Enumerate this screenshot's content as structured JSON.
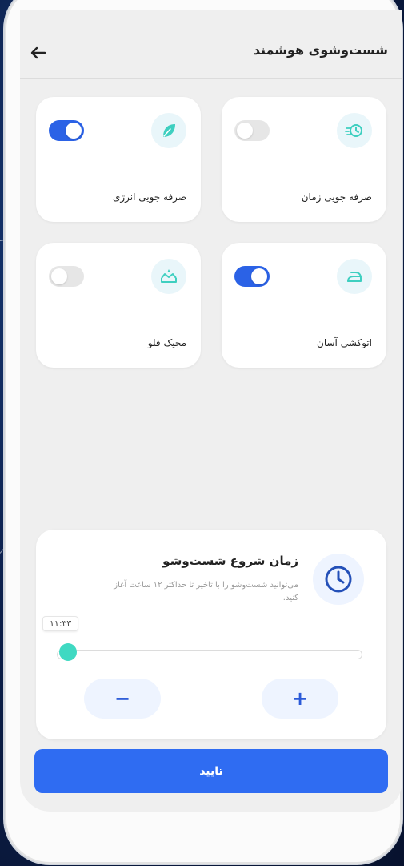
{
  "header": {
    "title": "شست‌وشوی هوشمند",
    "back_icon": "arrow-left-icon"
  },
  "options": [
    {
      "label": "صرفه جویی زمان",
      "icon": "fast-clock-icon",
      "enabled": false
    },
    {
      "label": "صرفه جویی انرژی",
      "icon": "leaf-icon",
      "enabled": true
    },
    {
      "label": "اتوکشی آسان",
      "icon": "iron-icon",
      "enabled": true
    },
    {
      "label": "مجیک فلو",
      "icon": "water-crown-icon",
      "enabled": false
    }
  ],
  "schedule": {
    "title": "زمان شروع شست‌وشو",
    "description": "می‌توانید شست‌وشو را با تاخیر تا حداکثر ۱۲ ساعت آغاز کنید.",
    "time_value": "۱۱:۳۳",
    "slider_fraction": 0.02,
    "minus_label": "−",
    "plus_label": "+",
    "icon": "clock-icon"
  },
  "confirm_label": "تایید",
  "colors": {
    "accent": "#2f6cf2",
    "toggle_on": "#2b62e6",
    "slider_thumb": "#3fd9c2",
    "icon_teal": "#3ecfc0"
  }
}
